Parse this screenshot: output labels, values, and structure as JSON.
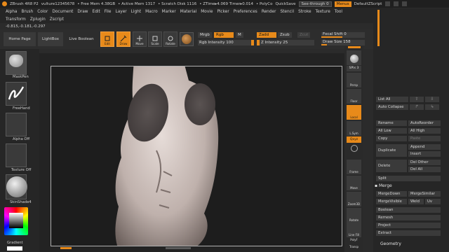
{
  "titlebar": {
    "app": "ZBrush 4R8 P2",
    "user": "vulture12345678",
    "free_mem": "• Free Mem 4.38GB",
    "active_mem": "• Active Mem 1317",
    "scratch": "• Scratch Disk 1116",
    "ztime": "• ZTime▸4.069 Timer▸0.014",
    "polycount": "• PolyCo",
    "quicksave": "QuickSave",
    "seethrough": "See-through  0",
    "menus": "Menus",
    "script": "DefaultZScript"
  },
  "menu": {
    "row1": [
      "Alpha",
      "Brush",
      "Color",
      "Document",
      "Draw",
      "Edit",
      "File",
      "Layer",
      "Light",
      "Macro",
      "Marker",
      "Material",
      "Movie",
      "Picker",
      "Preferences",
      "Render",
      "Stencil",
      "Stroke",
      "Texture",
      "Tool"
    ],
    "row2": [
      "Transform",
      "Zplugin",
      "Zscript"
    ]
  },
  "coords": "-0.815,-0.181,-0.297",
  "toolbar": {
    "home": "Home Page",
    "lightbox": "LightBox",
    "live_boolean": "Live Boolean",
    "edit": "Edit",
    "draw": "Draw",
    "move": "Move",
    "scale": "Scale",
    "rotate": "Rotate",
    "mrgb": "Mrgb",
    "rgb": "Rgb",
    "m": "M",
    "zadd": "Zadd",
    "zsub": "Zsub",
    "zcut": "Zcut",
    "rgb_intensity": "Rgb Intensity 100",
    "z_intensity": "Z Intensity 25",
    "focal_shift": "Focal Shift 0",
    "draw_size": "Draw Size 158"
  },
  "leftshelf": {
    "brush": "MaskPen",
    "stroke": "FreeHand",
    "alpha": "Alpha Off",
    "texture": "Texture Off",
    "material": "SkinShade4",
    "gradient": "Gradient"
  },
  "rightdock": {
    "spix": "SPix 3",
    "persp": "Persp",
    "floor": "Floor",
    "local": "Local",
    "lsym": "L.Sym",
    "xyz": "Qxyz",
    "frame": "Frame",
    "move": "Move",
    "zoom": "Zoom3D",
    "rotate": "Rotate",
    "linefill": "Line Fill",
    "polyf": "PolyF",
    "transp": "Transp"
  },
  "subtool": {
    "list_all": "List All",
    "auto_collapse": "Auto Collapse",
    "rename": "Rename",
    "auto_reorder": "AutoReorder",
    "all_low": "All Low",
    "all_high": "All High",
    "copy": "Copy",
    "paste": "Paste",
    "duplicate": "Duplicate",
    "append": "Append",
    "insert": "Insert",
    "delete": "Delete",
    "del_other": "Del Other",
    "del_all": "Del All",
    "split": "Split",
    "merge_header": "Merge",
    "merge_down": "MergeDown",
    "merge_similar": "MergeSimilar",
    "merge_visible": "MergeVisible",
    "weld": "Weld",
    "uv": "Uv",
    "boolean": "Boolean",
    "remesh": "Remesh",
    "project": "Project",
    "extract": "Extract",
    "geometry": "Geometry"
  },
  "colors": {
    "accent": "#e88a1a",
    "bg": "#2b2b2b",
    "canvas": "#1d1d1d"
  }
}
